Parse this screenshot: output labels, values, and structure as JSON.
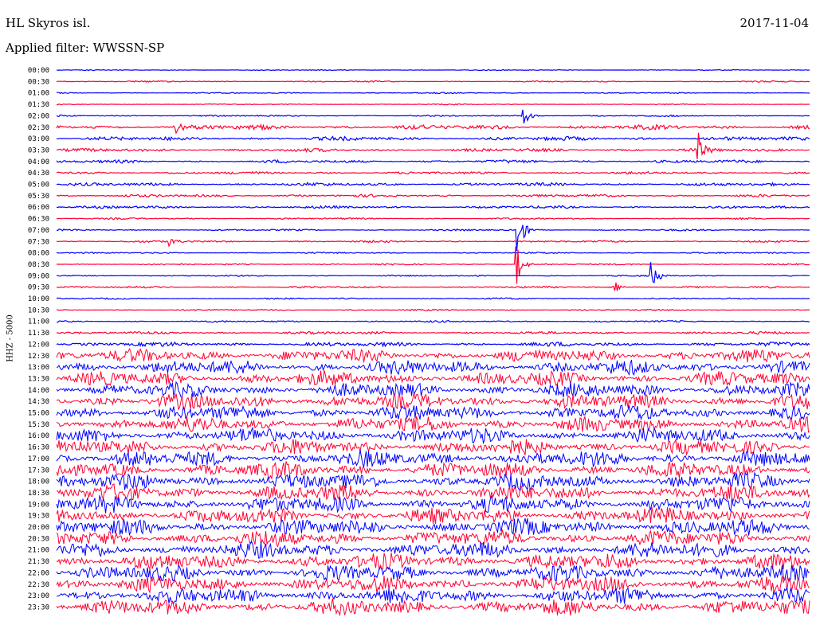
{
  "header": {
    "station": "HL Skyros isl.",
    "filter_label": "Applied filter: WWSSN-SP",
    "date": "2017-11-04"
  },
  "colors": {
    "trace_a": "#0000ff",
    "trace_b": "#ff0033",
    "text": "#000000",
    "background": "#ffffff"
  },
  "chart_data": {
    "type": "line",
    "title": "HL Skyros isl.",
    "subtitle": "Applied filter: WWSSN-SP",
    "date": "2017-11-04",
    "ylabel": "HHZ - 5000",
    "series_colors": [
      "#0000ff",
      "#ff0033"
    ],
    "rows": [
      {
        "label": "00:00",
        "amp": 0.6
      },
      {
        "label": "00:30",
        "amp": 0.8
      },
      {
        "label": "01:00",
        "amp": 0.7
      },
      {
        "label": "01:30",
        "amp": 0.6
      },
      {
        "label": "02:00",
        "amp": 1.0
      },
      {
        "label": "02:30",
        "amp": 2.8
      },
      {
        "label": "03:00",
        "amp": 2.4
      },
      {
        "label": "03:30",
        "amp": 2.0
      },
      {
        "label": "04:00",
        "amp": 1.9
      },
      {
        "label": "04:30",
        "amp": 1.6
      },
      {
        "label": "05:00",
        "amp": 2.0
      },
      {
        "label": "05:30",
        "amp": 1.6
      },
      {
        "label": "06:00",
        "amp": 1.6
      },
      {
        "label": "06:30",
        "amp": 1.0
      },
      {
        "label": "07:00",
        "amp": 1.0
      },
      {
        "label": "07:30",
        "amp": 1.2
      },
      {
        "label": "08:00",
        "amp": 0.9
      },
      {
        "label": "08:30",
        "amp": 0.9
      },
      {
        "label": "09:00",
        "amp": 0.9
      },
      {
        "label": "09:30",
        "amp": 1.1
      },
      {
        "label": "10:00",
        "amp": 0.9
      },
      {
        "label": "10:30",
        "amp": 0.9
      },
      {
        "label": "11:00",
        "amp": 1.1
      },
      {
        "label": "11:30",
        "amp": 1.6
      },
      {
        "label": "12:00",
        "amp": 2.6
      },
      {
        "label": "12:30",
        "amp": 8.0
      },
      {
        "label": "13:00",
        "amp": 9.0
      },
      {
        "label": "13:30",
        "amp": 9.0
      },
      {
        "label": "14:00",
        "amp": 9.0
      },
      {
        "label": "14:30",
        "amp": 9.5
      },
      {
        "label": "15:00",
        "amp": 9.5
      },
      {
        "label": "15:30",
        "amp": 9.5
      },
      {
        "label": "16:00",
        "amp": 9.5
      },
      {
        "label": "16:30",
        "amp": 9.5
      },
      {
        "label": "17:00",
        "amp": 10.0
      },
      {
        "label": "17:30",
        "amp": 10.0
      },
      {
        "label": "18:00",
        "amp": 10.0
      },
      {
        "label": "18:30",
        "amp": 10.0
      },
      {
        "label": "19:00",
        "amp": 10.0
      },
      {
        "label": "19:30",
        "amp": 10.0
      },
      {
        "label": "20:00",
        "amp": 10.0
      },
      {
        "label": "20:30",
        "amp": 10.0
      },
      {
        "label": "21:00",
        "amp": 10.0
      },
      {
        "label": "21:30",
        "amp": 10.0
      },
      {
        "label": "22:00",
        "amp": 10.0
      },
      {
        "label": "22:30",
        "amp": 10.0
      },
      {
        "label": "23:00",
        "amp": 10.0
      },
      {
        "label": "23:30",
        "amp": 10.0
      }
    ],
    "events": [
      {
        "row": "02:00",
        "time_fraction": 0.62,
        "amp": 14
      },
      {
        "row": "03:30",
        "time_fraction": 0.85,
        "amp": 30
      },
      {
        "row": "07:00",
        "time_fraction": 0.61,
        "amp": 45
      },
      {
        "row": "08:30",
        "time_fraction": 0.61,
        "amp": 30
      },
      {
        "row": "09:00",
        "time_fraction": 0.79,
        "amp": 18
      },
      {
        "row": "09:30",
        "time_fraction": 0.74,
        "amp": 9
      },
      {
        "row": "02:30",
        "time_fraction": 0.16,
        "amp": 9
      },
      {
        "row": "07:30",
        "time_fraction": 0.15,
        "amp": 7
      }
    ]
  }
}
